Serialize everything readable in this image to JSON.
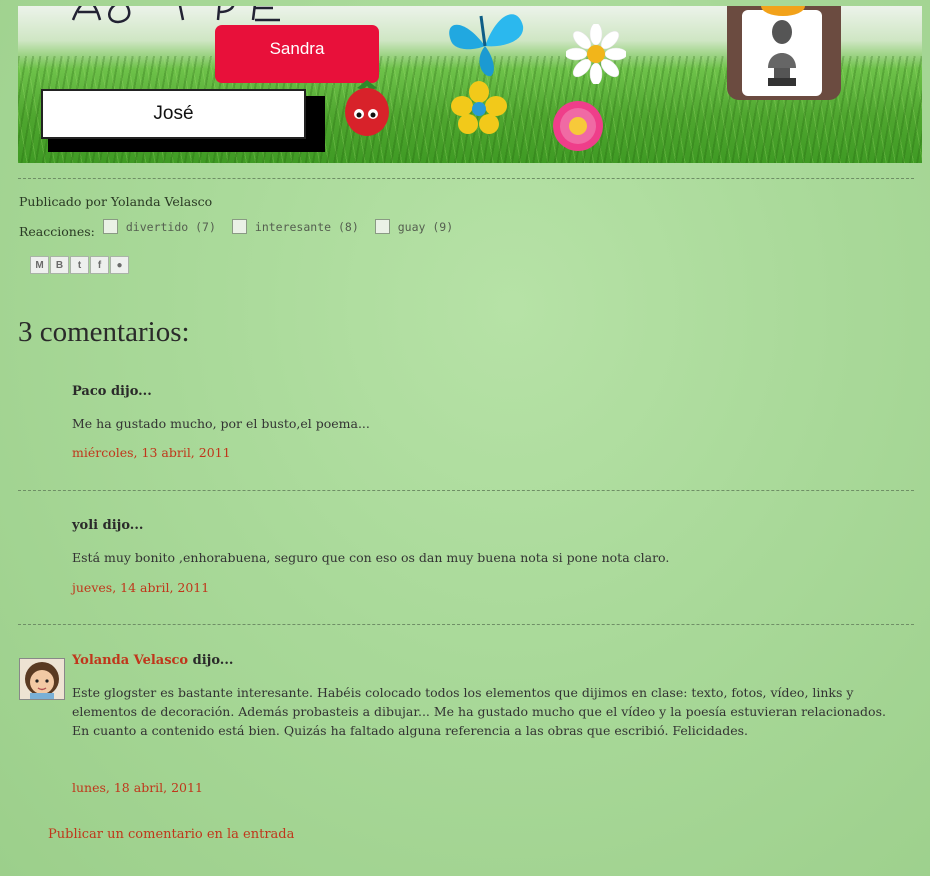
{
  "banner": {
    "sandra_label": "Sandra",
    "jose_label": "José",
    "icons": [
      "strawberry-icon",
      "butterfly-icon",
      "flower-icon",
      "daisy-icon",
      "pink-flower-icon",
      "bust-photo"
    ]
  },
  "post": {
    "posted_by": "Publicado por Yolanda Velasco",
    "reactions_label": "Reacciones:",
    "reactions": [
      {
        "label": "divertido (7)"
      },
      {
        "label": "interesante (8)"
      },
      {
        "label": "guay (9)"
      }
    ],
    "share_icons": [
      "email-icon",
      "blog-icon",
      "twitter-icon",
      "facebook-icon",
      "buzz-icon"
    ]
  },
  "comments": {
    "title": "3 comentarios:",
    "items": [
      {
        "author": "Paco",
        "said": " dijo...",
        "body": "Me ha gustado mucho, por el busto,el poema...",
        "date": "miércoles, 13 abril, 2011"
      },
      {
        "author": "yoli",
        "said": " dijo...",
        "body": "Está muy bonito ,enhorabuena, seguro que con eso os dan muy buena nota si pone nota claro.",
        "date": "jueves, 14 abril, 2011"
      },
      {
        "author": "Yolanda Velasco",
        "said": " dijo...",
        "body": "Este glogster es bastante interesante. Habéis colocado todos los elementos que dijimos en clase: texto, fotos, vídeo, links y elementos de decoración. Además probasteis a dibujar... Me ha gustado mucho que el vídeo y la poesía estuvieran relacionados. En cuanto a contenido está bien. Quizás ha faltado alguna referencia a las obras que escribió. Felicidades.",
        "date": "lunes, 18 abril, 2011"
      }
    ],
    "publish_link": "Publicar un comentario en la entrada"
  },
  "colors": {
    "background": "#a9d999",
    "link": "#c0361b",
    "sandra_button": "#e8103a"
  }
}
